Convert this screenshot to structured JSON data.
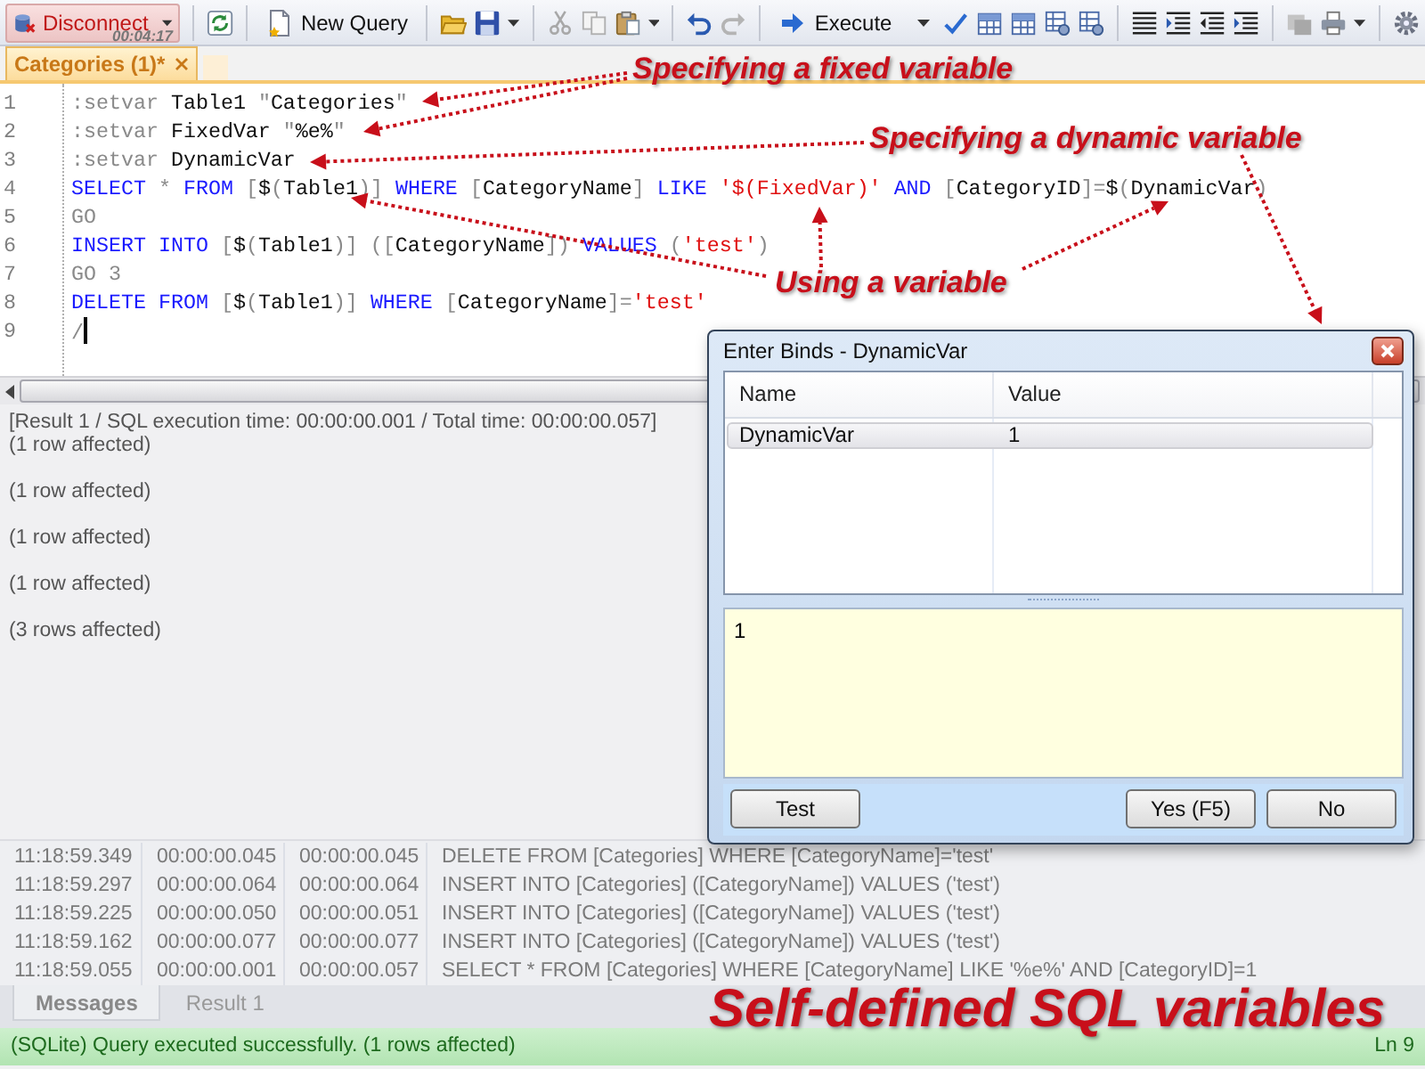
{
  "toolbar": {
    "disconnect": {
      "label": "Disconnect",
      "timer": "00:04:17"
    },
    "new_query": "New Query",
    "execute": "Execute"
  },
  "editor_tabs": [
    {
      "label": "Categories (1)*",
      "selected": true
    }
  ],
  "editor": {
    "lines": [
      {
        "number": "1",
        "caret": false,
        "tokens": [
          {
            "kind": "dim",
            "text": ":setvar"
          },
          {
            "kind": "plain",
            "text": " Table1 "
          },
          {
            "kind": "dim",
            "text": "\""
          },
          {
            "kind": "plain",
            "text": "Categories"
          },
          {
            "kind": "dim",
            "text": "\""
          }
        ]
      },
      {
        "number": "2",
        "caret": false,
        "tokens": [
          {
            "kind": "dim",
            "text": ":setvar"
          },
          {
            "kind": "plain",
            "text": " FixedVar "
          },
          {
            "kind": "dim",
            "text": "\""
          },
          {
            "kind": "plain",
            "text": "%e%"
          },
          {
            "kind": "dim",
            "text": "\""
          }
        ]
      },
      {
        "number": "3",
        "caret": false,
        "tokens": [
          {
            "kind": "dim",
            "text": ":setvar"
          },
          {
            "kind": "plain",
            "text": " DynamicVar"
          }
        ]
      },
      {
        "number": "4",
        "caret": false,
        "tokens": [
          {
            "kind": "keyword",
            "text": "SELECT"
          },
          {
            "kind": "dim",
            "text": " * "
          },
          {
            "kind": "keyword",
            "text": "FROM"
          },
          {
            "kind": "dim",
            "text": " ["
          },
          {
            "kind": "plain",
            "text": "$"
          },
          {
            "kind": "dim",
            "text": "("
          },
          {
            "kind": "plain",
            "text": "Table1"
          },
          {
            "kind": "dim",
            "text": ")] "
          },
          {
            "kind": "keyword",
            "text": "WHERE"
          },
          {
            "kind": "dim",
            "text": " ["
          },
          {
            "kind": "plain",
            "text": "CategoryName"
          },
          {
            "kind": "dim",
            "text": "] "
          },
          {
            "kind": "keyword",
            "text": "LIKE"
          },
          {
            "kind": "string",
            "text": " '$(FixedVar)' "
          },
          {
            "kind": "keyword",
            "text": "AND"
          },
          {
            "kind": "dim",
            "text": " ["
          },
          {
            "kind": "plain",
            "text": "CategoryID"
          },
          {
            "kind": "dim",
            "text": "]="
          },
          {
            "kind": "plain",
            "text": "$"
          },
          {
            "kind": "dim",
            "text": "("
          },
          {
            "kind": "plain",
            "text": "DynamicVar"
          },
          {
            "kind": "dim",
            "text": ")"
          }
        ]
      },
      {
        "number": "5",
        "caret": false,
        "tokens": [
          {
            "kind": "dim",
            "text": "GO"
          }
        ]
      },
      {
        "number": "6",
        "caret": false,
        "tokens": [
          {
            "kind": "keyword",
            "text": "INSERT INTO"
          },
          {
            "kind": "dim",
            "text": " ["
          },
          {
            "kind": "plain",
            "text": "$"
          },
          {
            "kind": "dim",
            "text": "("
          },
          {
            "kind": "plain",
            "text": "Table1"
          },
          {
            "kind": "dim",
            "text": ")] (["
          },
          {
            "kind": "plain",
            "text": "CategoryName"
          },
          {
            "kind": "dim",
            "text": "]) "
          },
          {
            "kind": "keyword",
            "text": "VALUES"
          },
          {
            "kind": "dim",
            "text": " ("
          },
          {
            "kind": "string",
            "text": "'test'"
          },
          {
            "kind": "dim",
            "text": ")"
          }
        ]
      },
      {
        "number": "7",
        "caret": false,
        "tokens": [
          {
            "kind": "dim",
            "text": "GO 3"
          }
        ]
      },
      {
        "number": "8",
        "caret": false,
        "tokens": [
          {
            "kind": "keyword",
            "text": "DELETE FROM"
          },
          {
            "kind": "dim",
            "text": " ["
          },
          {
            "kind": "plain",
            "text": "$"
          },
          {
            "kind": "dim",
            "text": "("
          },
          {
            "kind": "plain",
            "text": "Table1"
          },
          {
            "kind": "dim",
            "text": ")] "
          },
          {
            "kind": "keyword",
            "text": "WHERE"
          },
          {
            "kind": "dim",
            "text": " ["
          },
          {
            "kind": "plain",
            "text": "CategoryName"
          },
          {
            "kind": "dim",
            "text": "]="
          },
          {
            "kind": "string",
            "text": "'test'"
          }
        ]
      },
      {
        "number": "9",
        "caret": true,
        "tokens": [
          {
            "kind": "dim",
            "text": "/"
          }
        ]
      }
    ]
  },
  "annotations": [
    {
      "text": "Specifying a fixed variable",
      "kind": "small"
    },
    {
      "text": "Specifying a dynamic variable",
      "kind": "small"
    },
    {
      "text": "Using a variable",
      "kind": "small"
    },
    {
      "text": "Self-defined SQL variables",
      "kind": "large"
    }
  ],
  "messages": [
    "[Result 1 / SQL execution time: 00:00:00.001 / Total time: 00:00:00.057]",
    "(1 row affected)",
    "(1 row affected)",
    "(1 row affected)",
    "(1 row affected)",
    "(3 rows affected)"
  ],
  "log": {
    "rows": [
      [
        "11:18:59.349",
        "00:00:00.045",
        "00:00:00.045",
        "DELETE FROM [Categories] WHERE [CategoryName]='test'"
      ],
      [
        "11:18:59.297",
        "00:00:00.064",
        "00:00:00.064",
        "INSERT INTO [Categories] ([CategoryName]) VALUES ('test')"
      ],
      [
        "11:18:59.225",
        "00:00:00.050",
        "00:00:00.051",
        "INSERT INTO [Categories] ([CategoryName]) VALUES ('test')"
      ],
      [
        "11:18:59.162",
        "00:00:00.077",
        "00:00:00.077",
        "INSERT INTO [Categories] ([CategoryName]) VALUES ('test')"
      ],
      [
        "11:18:59.055",
        "00:00:00.001",
        "00:00:00.057",
        "SELECT * FROM [Categories] WHERE [CategoryName] LIKE '%e%' AND [CategoryID]=1"
      ]
    ]
  },
  "result_tabs": [
    {
      "label": "Messages",
      "selected": true
    },
    {
      "label": "Result 1",
      "selected": false
    }
  ],
  "status_bar": {
    "message": "(SQLite) Query executed successfully. (1 rows affected)",
    "position": "Ln 9"
  },
  "dialog": {
    "title": "Enter Binds - DynamicVar",
    "columns": [
      "Name",
      "Value"
    ],
    "rows": [
      {
        "cells": [
          "DynamicVar",
          "1"
        ],
        "selected": true
      }
    ],
    "value": "1",
    "buttons": [
      "Test",
      "Yes (F5)",
      "No"
    ]
  }
}
